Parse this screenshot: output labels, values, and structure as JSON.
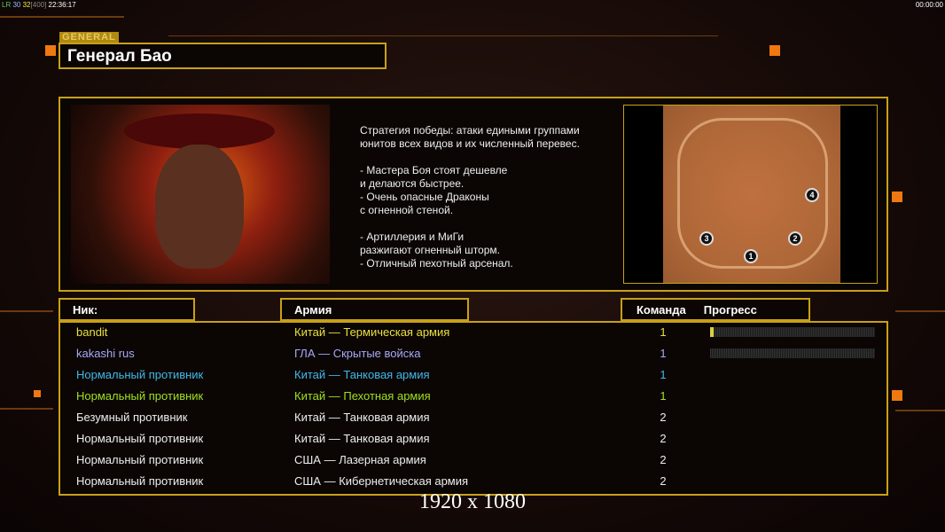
{
  "hud": {
    "left_prefix": "LR",
    "fps1": "30",
    "fps2": "32",
    "limit": "[400]",
    "clock": "22:36:17",
    "right_clock": "00:00:00"
  },
  "general": {
    "tag": "GENERAL",
    "name": "Генерал Бао"
  },
  "description": "Стратегия победы: атаки едиными группами\nюнитов всех видов и их численный перевес.\n\n- Мастера Боя стоят дешевле\nи делаются быстрее.\n- Очень опасные Драконы\nс огненной стеной.\n\n- Артиллерия и МиГи\nразжигают огненный шторм.\n- Отличный пехотный арсенал.",
  "map": {
    "spawns": [
      "1",
      "2",
      "3",
      "4"
    ]
  },
  "headers": {
    "nick": "Ник:",
    "army": "Армия",
    "team": "Команда",
    "progress": "Прогресс"
  },
  "colors": {
    "accent": "#c8a018",
    "yellow": "#e8e040",
    "lavender": "#a8a8f8",
    "cyan": "#40b8e8",
    "lime": "#a0e020",
    "white": "#eeeeee"
  },
  "players": [
    {
      "nick": "bandit",
      "army": "Китай — Термическая армия",
      "team": "1",
      "color": "#e8e040",
      "progress": 0.02
    },
    {
      "nick": "kakashi rus",
      "army": "ГЛА — Скрытые войска",
      "team": "1",
      "color": "#a8a8f8",
      "progress": 0
    },
    {
      "nick": "Нормальный противник",
      "army": "Китай — Танковая армия",
      "team": "1",
      "color": "#40b8e8"
    },
    {
      "nick": "Нормальный противник",
      "army": "Китай — Пехотная армия",
      "team": "1",
      "color": "#a0e020"
    },
    {
      "nick": "Безумный противник",
      "army": "Китай — Танковая армия",
      "team": "2",
      "color": "#eeeeee"
    },
    {
      "nick": "Нормальный противник",
      "army": "Китай — Танковая армия",
      "team": "2",
      "color": "#eeeeee"
    },
    {
      "nick": "Нормальный противник",
      "army": "США — Лазерная армия",
      "team": "2",
      "color": "#eeeeee"
    },
    {
      "nick": "Нормальный противник",
      "army": "США — Кибернетическая армия",
      "team": "2",
      "color": "#eeeeee"
    }
  ],
  "resolution": "1920 x 1080"
}
